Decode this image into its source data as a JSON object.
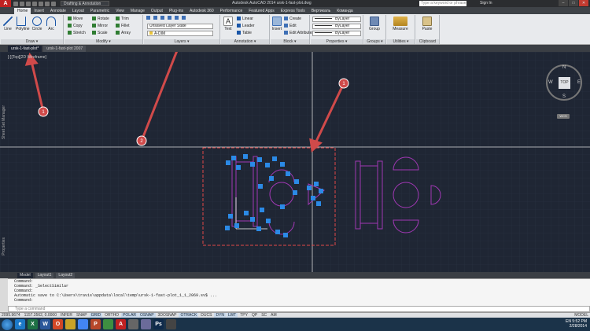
{
  "titlebar": {
    "logo": "A",
    "workspace": "Drafting & Annotation",
    "title": "Autodesk AutoCAD 2014   ursk-1-fast-plot.dwg",
    "search_placeholder": "Type a keyword or phrase",
    "signin": "Sign In",
    "min": "–",
    "max": "□",
    "close": "✕"
  },
  "ribbon_tabs": [
    "Home",
    "Insert",
    "Annotate",
    "Layout",
    "Parametric",
    "View",
    "Manage",
    "Output",
    "Plug-ins",
    "Autodesk 360",
    "Performance",
    "Featured Apps",
    "Express Tools",
    "Вертикаль",
    "Команда"
  ],
  "draw": {
    "title": "Draw ▾",
    "line": "Line",
    "polyline": "Polyline",
    "circle": "Circle",
    "arc": "Arc"
  },
  "modify": {
    "title": "Modify ▾",
    "move": "Move",
    "rotate": "Rotate",
    "trim": "Trim",
    "copy": "Copy",
    "mirror": "Mirror",
    "fillet": "Fillet",
    "stretch": "Stretch",
    "scale": "Scale",
    "array": "Array"
  },
  "layers": {
    "title": "Layers ▾",
    "state": "Unsaved Layer State",
    "current": "A-DIM"
  },
  "annotation": {
    "title": "Annotation ▾",
    "text": "Text",
    "linear": "Linear",
    "leader": "Leader",
    "table": "Table"
  },
  "block": {
    "title": "Block ▾",
    "insert": "Insert",
    "create": "Create",
    "edit": "Edit",
    "edit_attributes": "Edit Attributes"
  },
  "properties": {
    "title": "Properties ▾",
    "bylayer1": "ByLayer",
    "bylayer2": "ByLayer",
    "bylayer3": "ByLayer"
  },
  "groups": {
    "title": "Groups ▾",
    "group": "Group"
  },
  "utilities": {
    "title": "Utilities ▾",
    "measure": "Measure"
  },
  "clipboard": {
    "title": "Clipboard",
    "paste": "Paste"
  },
  "file_tabs": [
    "ursk-1-fast-plot*",
    "ursk-1-fast-plot 2007"
  ],
  "viewport_label": "[-][Top][2D Wireframe]",
  "sidebar": {
    "top": "Sheet Set Manager",
    "bottom": "Properties"
  },
  "viewcube": {
    "n": "N",
    "s": "S",
    "e": "E",
    "w": "W",
    "top": "TOP",
    "wcs": "WCS"
  },
  "callouts": [
    "1",
    "2",
    "1"
  ],
  "layout_tabs": [
    "Model",
    "Layout1",
    "Layout2"
  ],
  "command_lines": [
    "Command:",
    "Command: _SelectSimilar",
    "Command:",
    "Automatic save to C:\\Users\\travis\\appdata\\local\\temp\\ursk-1-fast-plot_1_1_2069.sv$ ...",
    "Command:"
  ],
  "command_placeholder": "Type a command",
  "status_items": [
    {
      "label": "2095.9674",
      "on": false
    },
    {
      "label": "1157.3562, 0.0000",
      "on": false
    },
    {
      "label": "INFER",
      "on": false
    },
    {
      "label": "SNAP",
      "on": false
    },
    {
      "label": "GRID",
      "on": true
    },
    {
      "label": "ORTHO",
      "on": false
    },
    {
      "label": "POLAR",
      "on": true
    },
    {
      "label": "OSNAP",
      "on": true
    },
    {
      "label": "3DOSNAP",
      "on": false
    },
    {
      "label": "OTRACK",
      "on": true
    },
    {
      "label": "DUCS",
      "on": false
    },
    {
      "label": "DYN",
      "on": true
    },
    {
      "label": "LWT",
      "on": true
    },
    {
      "label": "TPY",
      "on": false
    },
    {
      "label": "QP",
      "on": false
    },
    {
      "label": "SC",
      "on": false
    },
    {
      "label": "AM",
      "on": false
    }
  ],
  "status_right": "MODEL",
  "taskbar_apps": [
    {
      "label": "e",
      "color": "#1c79c8"
    },
    {
      "label": "X",
      "color": "#1e7145"
    },
    {
      "label": "W",
      "color": "#2b579a"
    },
    {
      "label": "O",
      "color": "#d24726"
    },
    {
      "label": "",
      "color": "#c9a227"
    },
    {
      "label": "",
      "color": "#4285f4"
    },
    {
      "label": "P",
      "color": "#b7472a"
    },
    {
      "label": "",
      "color": "#3e8e41"
    },
    {
      "label": "A",
      "color": "#c02222"
    },
    {
      "label": "",
      "color": "#666"
    },
    {
      "label": "",
      "color": "#6b6b9a"
    },
    {
      "label": "Ps",
      "color": "#0f2a4b"
    },
    {
      "label": "",
      "color": "#444"
    }
  ],
  "tray": {
    "lang": "EN",
    "time": "5:52 PM",
    "date": "2/28/2014"
  }
}
